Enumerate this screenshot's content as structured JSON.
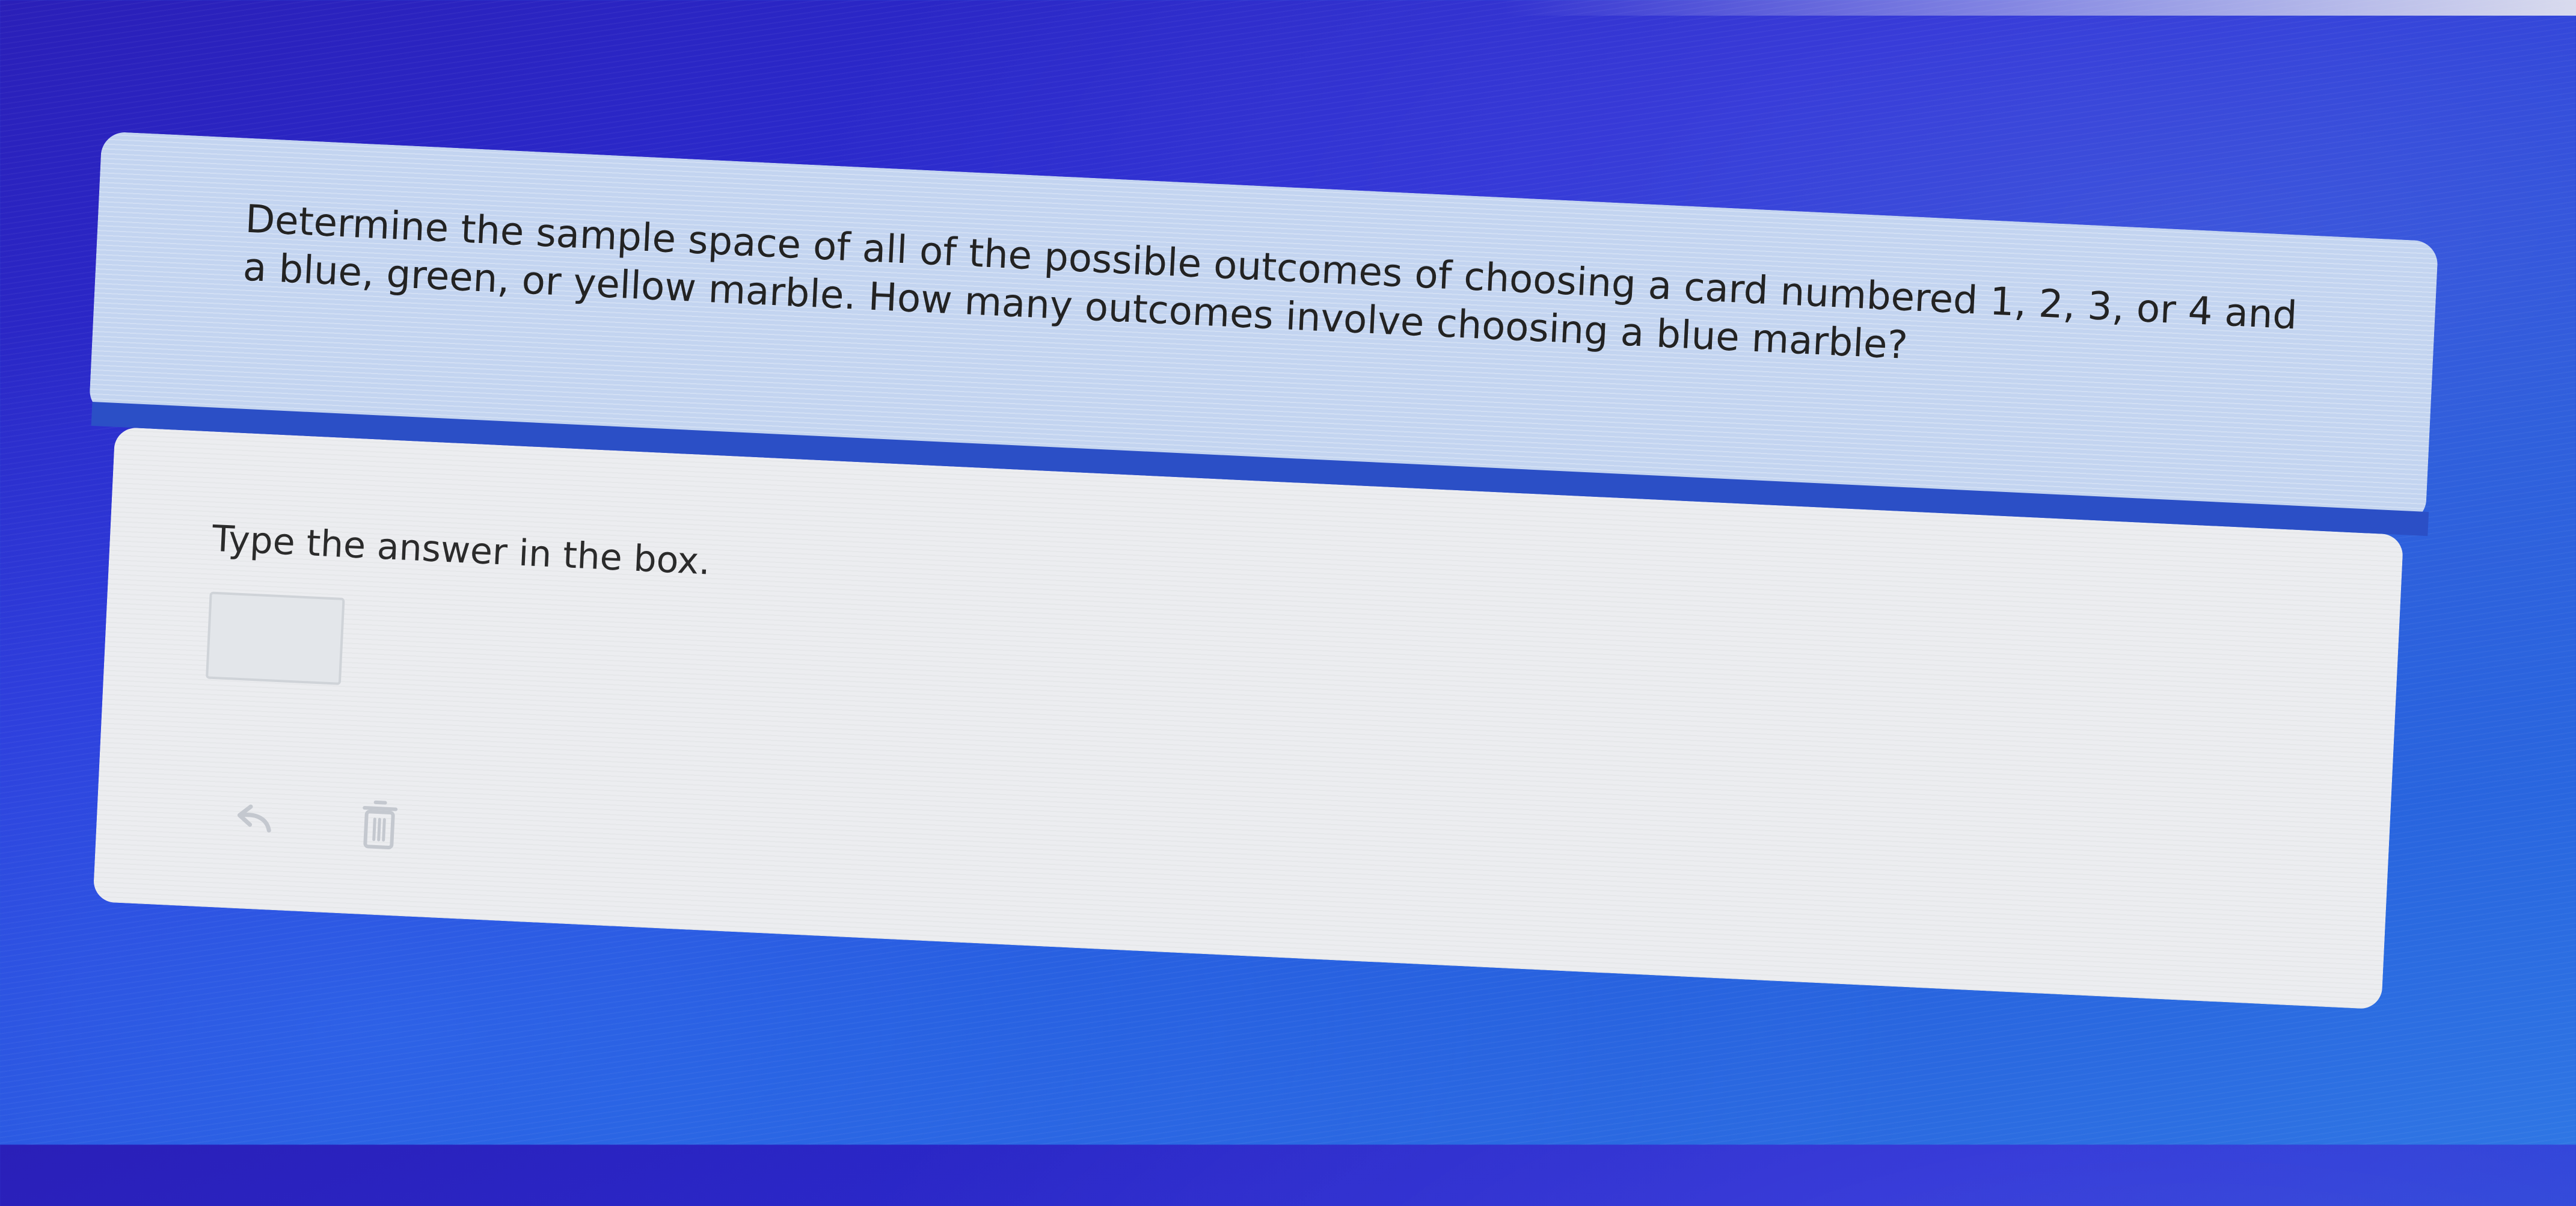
{
  "question": {
    "text": "Determine the sample space of all of the possible outcomes of choosing a card numbered 1, 2, 3, or 4 and a blue, green, or yellow marble. How many outcomes involve choosing a blue marble?"
  },
  "answer": {
    "instruction": "Type the answer in the box.",
    "input_value": "",
    "input_placeholder": ""
  },
  "tools": {
    "undo_icon": "undo-arrow-icon",
    "delete_icon": "trash-can-icon"
  },
  "colors": {
    "background": "#2b2fd6",
    "question_card": "#c3d4f0",
    "answer_card": "#ecedf0"
  }
}
